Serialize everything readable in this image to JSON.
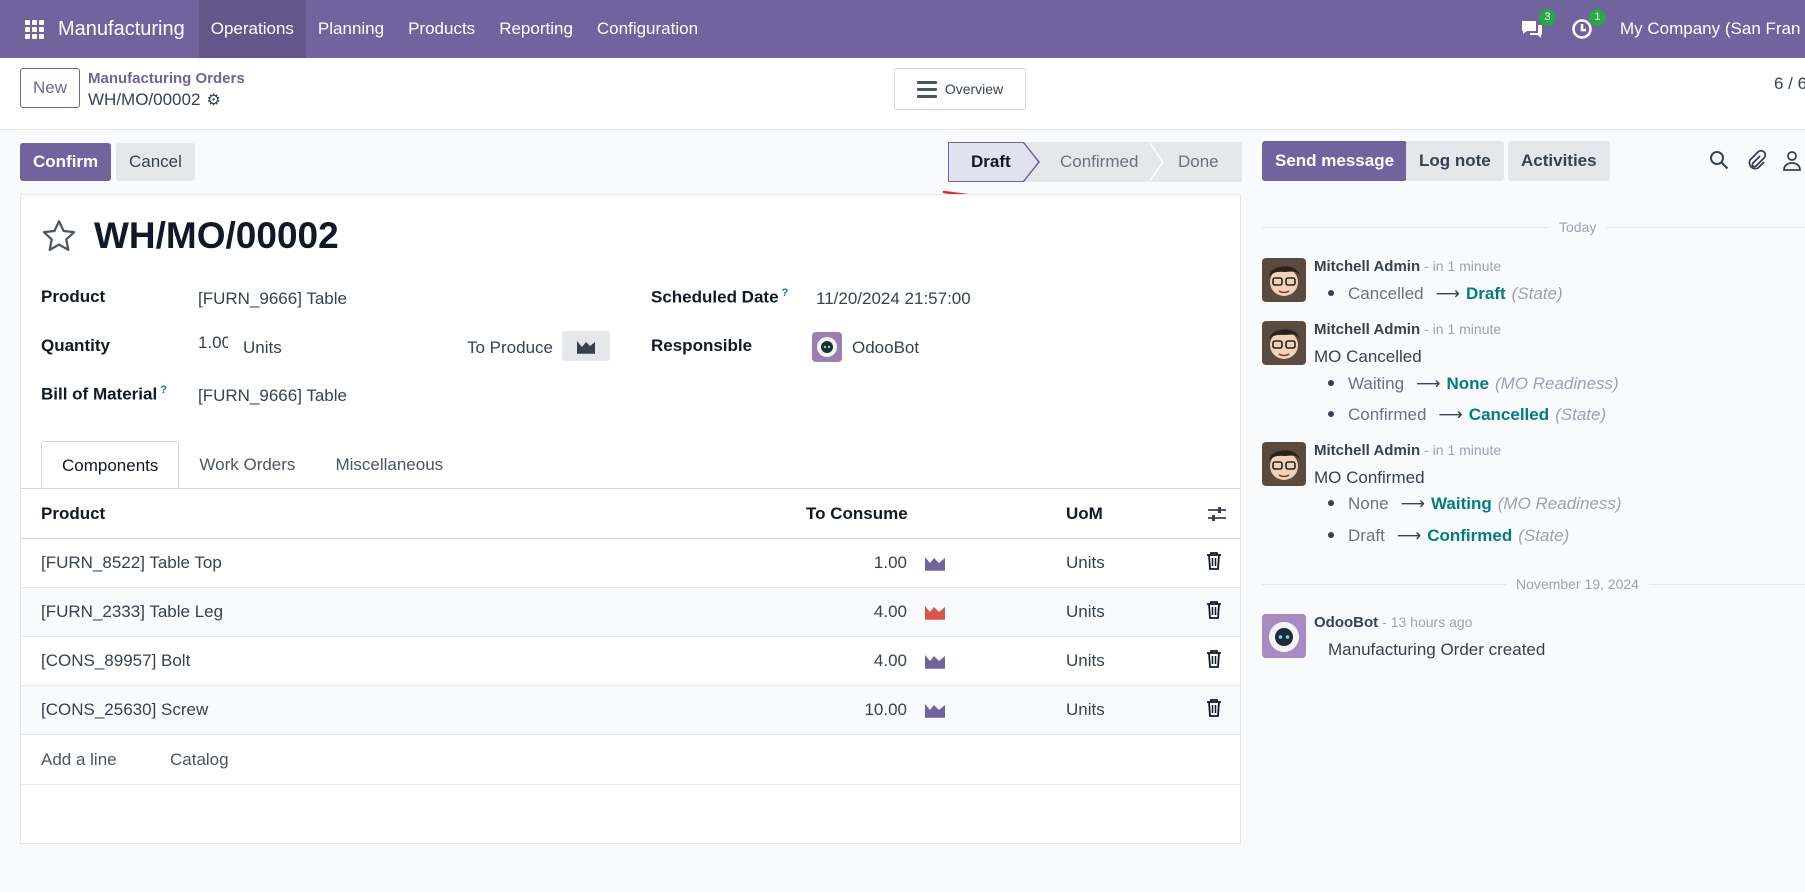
{
  "navbar": {
    "app_name": "Manufacturing",
    "menu": [
      "Operations",
      "Planning",
      "Products",
      "Reporting",
      "Configuration"
    ],
    "messages_badge": "3",
    "activities_badge": "1",
    "company": "My Company (San Fran"
  },
  "control": {
    "new_label": "New",
    "breadcrumb_parent": "Manufacturing Orders",
    "breadcrumb_current": "WH/MO/00002",
    "overview_label": "Overview",
    "pager": "6 / 6"
  },
  "actions": {
    "confirm_label": "Confirm",
    "cancel_label": "Cancel"
  },
  "statusbar": {
    "stages": [
      "Draft",
      "Confirmed",
      "Done"
    ],
    "current": "Draft"
  },
  "form": {
    "title": "WH/MO/00002",
    "product_label": "Product",
    "product_value": "[FURN_9666] Table",
    "quantity_label": "Quantity",
    "quantity_value": "1.00",
    "quantity_uom": "Units",
    "to_produce_label": "To Produce",
    "bom_label": "Bill of Material",
    "bom_help": "?",
    "bom_value": "[FURN_9666] Table",
    "scheduled_label": "Scheduled Date",
    "scheduled_help": "?",
    "scheduled_value": "11/20/2024 21:57:00",
    "responsible_label": "Responsible",
    "responsible_value": "OdooBot"
  },
  "tabs": [
    "Components",
    "Work Orders",
    "Miscellaneous"
  ],
  "components": {
    "headers": {
      "product": "Product",
      "to_consume": "To Consume",
      "uom": "UoM"
    },
    "rows": [
      {
        "product": "[FURN_8522] Table Top",
        "qty": "1.00",
        "uom": "Units",
        "forecast_color": "#71639e"
      },
      {
        "product": "[FURN_2333] Table Leg",
        "qty": "4.00",
        "uom": "Units",
        "forecast_color": "#d9534f"
      },
      {
        "product": "[CONS_89957] Bolt",
        "qty": "4.00",
        "uom": "Units",
        "forecast_color": "#71639e"
      },
      {
        "product": "[CONS_25630] Screw",
        "qty": "10.00",
        "uom": "Units",
        "forecast_color": "#71639e"
      }
    ],
    "add_line": "Add a line",
    "catalog": "Catalog"
  },
  "chatter": {
    "send_message": "Send message",
    "log_note": "Log note",
    "activities": "Activities",
    "sep_today": "Today",
    "sep_date": "November 19, 2024",
    "m1": {
      "author": "Mitchell Admin",
      "when": "- in 1 minute",
      "c1_old": "Cancelled",
      "c1_new": "Draft",
      "c1_field": "(State)"
    },
    "m2": {
      "author": "Mitchell Admin",
      "when": "- in 1 minute",
      "body": "MO Cancelled",
      "c1_old": "Waiting",
      "c1_new": "None",
      "c1_field": "(MO Readiness)",
      "c2_old": "Confirmed",
      "c2_new": "Cancelled",
      "c2_field": "(State)"
    },
    "m3": {
      "author": "Mitchell Admin",
      "when": "- in 1 minute",
      "body": "MO Confirmed",
      "c1_old": "None",
      "c1_new": "Waiting",
      "c1_field": "(MO Readiness)",
      "c2_old": "Draft",
      "c2_new": "Confirmed",
      "c2_field": "(State)"
    },
    "m4": {
      "author": "OdooBot",
      "when": "- 13 hours ago",
      "body": "Manufacturing Order created"
    }
  },
  "colors": {
    "brand": "#71639e",
    "link": "#017e84",
    "annotation": "#d92b2b"
  }
}
